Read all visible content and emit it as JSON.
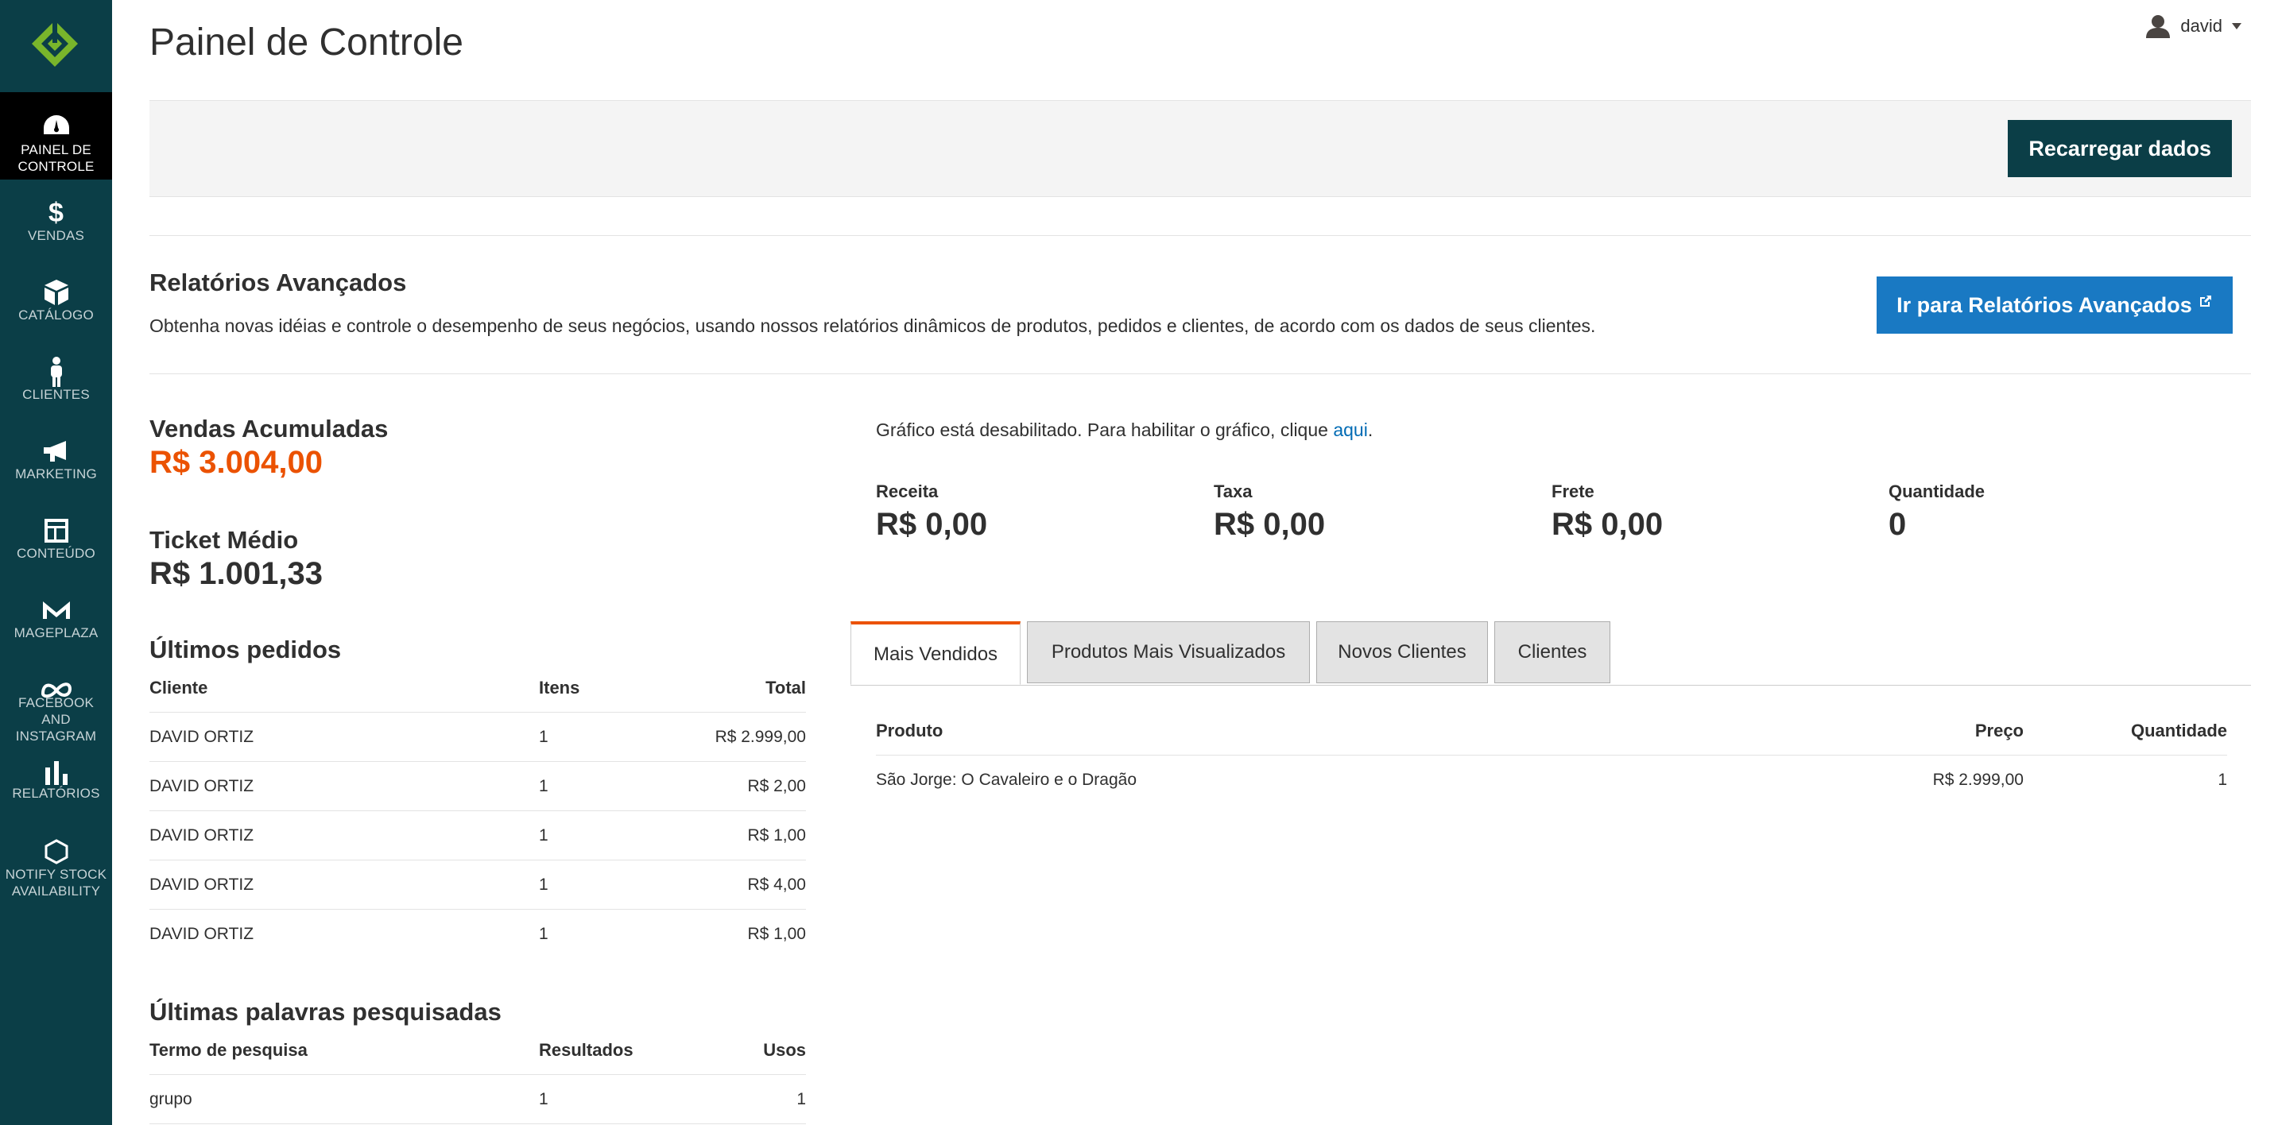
{
  "sidebar": {
    "items": [
      {
        "label": "PAINEL DE CONTROLE",
        "icon": "dashboard-icon"
      },
      {
        "label": "VENDAS",
        "icon": "dollar-icon"
      },
      {
        "label": "CATÁLOGO",
        "icon": "box-icon"
      },
      {
        "label": "CLIENTES",
        "icon": "person-icon"
      },
      {
        "label": "MARKETING",
        "icon": "megaphone-icon"
      },
      {
        "label": "CONTEÚDO",
        "icon": "layout-icon"
      },
      {
        "label": "MAGEPLAZA",
        "icon": "mageplaza-icon"
      },
      {
        "label": "FACEBOOK AND INSTAGRAM",
        "icon": "meta-icon"
      },
      {
        "label": "RELATÓRIOS",
        "icon": "bar-chart-icon"
      },
      {
        "label": "NOTIFY STOCK AVAILABILITY",
        "icon": "hexagon-icon"
      }
    ]
  },
  "header": {
    "title": "Painel de Controle",
    "user": "david",
    "reload_label": "Recarregar dados"
  },
  "advanced": {
    "title": "Relatórios Avançados",
    "description": "Obtenha novas idéias e controle o desempenho de seus negócios, usando nossos relatórios dinâmicos de produtos, pedidos e clientes, de acordo com os dados de seus clientes.",
    "button_label": "Ir para Relatórios Avançados"
  },
  "stats": {
    "lifetime_label": "Vendas Acumuladas",
    "lifetime_value": "R$ 3.004,00",
    "average_label": "Ticket Médio",
    "average_value": "R$ 1.001,33"
  },
  "last_orders": {
    "title": "Últimos pedidos",
    "headers": {
      "customer": "Cliente",
      "items": "Itens",
      "total": "Total"
    },
    "rows": [
      {
        "customer": "DAVID ORTIZ",
        "items": "1",
        "total": "R$ 2.999,00"
      },
      {
        "customer": "DAVID ORTIZ",
        "items": "1",
        "total": "R$ 2,00"
      },
      {
        "customer": "DAVID ORTIZ",
        "items": "1",
        "total": "R$ 1,00"
      },
      {
        "customer": "DAVID ORTIZ",
        "items": "1",
        "total": "R$ 4,00"
      },
      {
        "customer": "DAVID ORTIZ",
        "items": "1",
        "total": "R$ 1,00"
      }
    ]
  },
  "last_search": {
    "title": "Últimas palavras pesquisadas",
    "headers": {
      "term": "Termo de pesquisa",
      "results": "Resultados",
      "uses": "Usos"
    },
    "rows": [
      {
        "term": "grupo",
        "results": "1",
        "uses": "1"
      }
    ]
  },
  "chart": {
    "note": "Gráfico está desabilitado. Para habilitar o gráfico, clique ",
    "link": "aqui",
    "period": "."
  },
  "kpis": [
    {
      "label": "Receita",
      "value": "R$ 0,00"
    },
    {
      "label": "Taxa",
      "value": "R$ 0,00"
    },
    {
      "label": "Frete",
      "value": "R$ 0,00"
    },
    {
      "label": "Quantidade",
      "value": "0"
    }
  ],
  "tabs": [
    "Mais Vendidos",
    "Produtos Mais Visualizados",
    "Novos Clientes",
    "Clientes"
  ],
  "bestsellers": {
    "headers": {
      "product": "Produto",
      "price": "Preço",
      "qty": "Quantidade"
    },
    "rows": [
      {
        "product": "São Jorge: O Cavaleiro e o Dragão",
        "price": "R$ 2.999,00",
        "qty": "1"
      }
    ]
  },
  "colors": {
    "sidebar": "#0b3e47",
    "accent": "#eb5202",
    "link": "#006bb4",
    "primary_button": "#1979c3"
  }
}
